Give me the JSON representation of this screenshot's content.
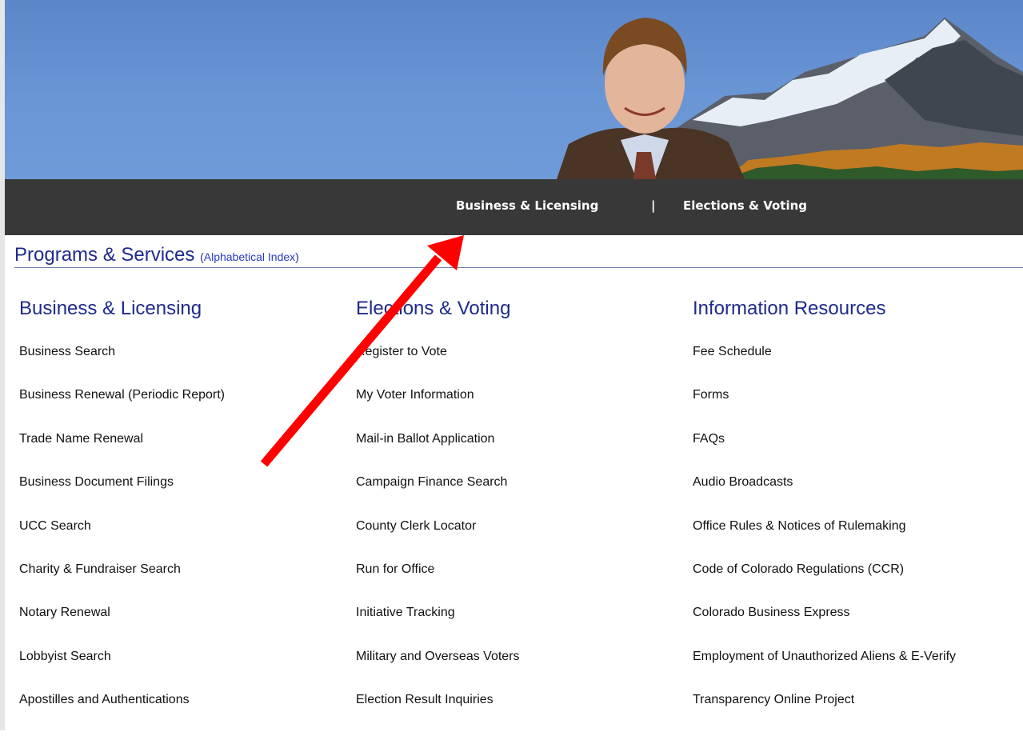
{
  "nav": {
    "business_licensing": "Business & Licensing",
    "separator": "|",
    "elections_voting": "Elections & Voting"
  },
  "section": {
    "title": "Programs & Services",
    "paren_open": "(",
    "index_link": "Alphabetical Index",
    "paren_close": ")"
  },
  "columns": [
    {
      "heading": "Business & Licensing",
      "items": [
        "Business Search",
        "Business Renewal (Periodic Report)",
        "Trade Name Renewal",
        "Business Document Filings",
        "UCC Search",
        "Charity & Fundraiser Search",
        "Notary Renewal",
        "Lobbyist Search",
        "Apostilles and Authentications"
      ]
    },
    {
      "heading": "Elections & Voting",
      "items": [
        "Register to Vote",
        "My Voter Information",
        "Mail-in Ballot Application",
        "Campaign Finance Search",
        "County Clerk Locator",
        "Run for Office",
        "Initiative Tracking",
        "Military and Overseas Voters",
        "Election Result Inquiries"
      ]
    },
    {
      "heading": "Information Resources",
      "items": [
        "Fee Schedule",
        "Forms",
        "FAQs",
        "Audio Broadcasts",
        "Office Rules & Notices of Rulemaking",
        "Code of Colorado Regulations (CCR)",
        "Colorado Business Express",
        "Employment of Unauthorized Aliens & E-Verify",
        "Transparency Online Project"
      ]
    }
  ],
  "colors": {
    "heading": "#1f2a8c",
    "link": "#2a38c9",
    "navbar": "#383838",
    "banner_blue": "#6a96d6",
    "annotation_arrow": "#ff0000"
  },
  "icons": {
    "annotation": "red-arrow-icon"
  }
}
